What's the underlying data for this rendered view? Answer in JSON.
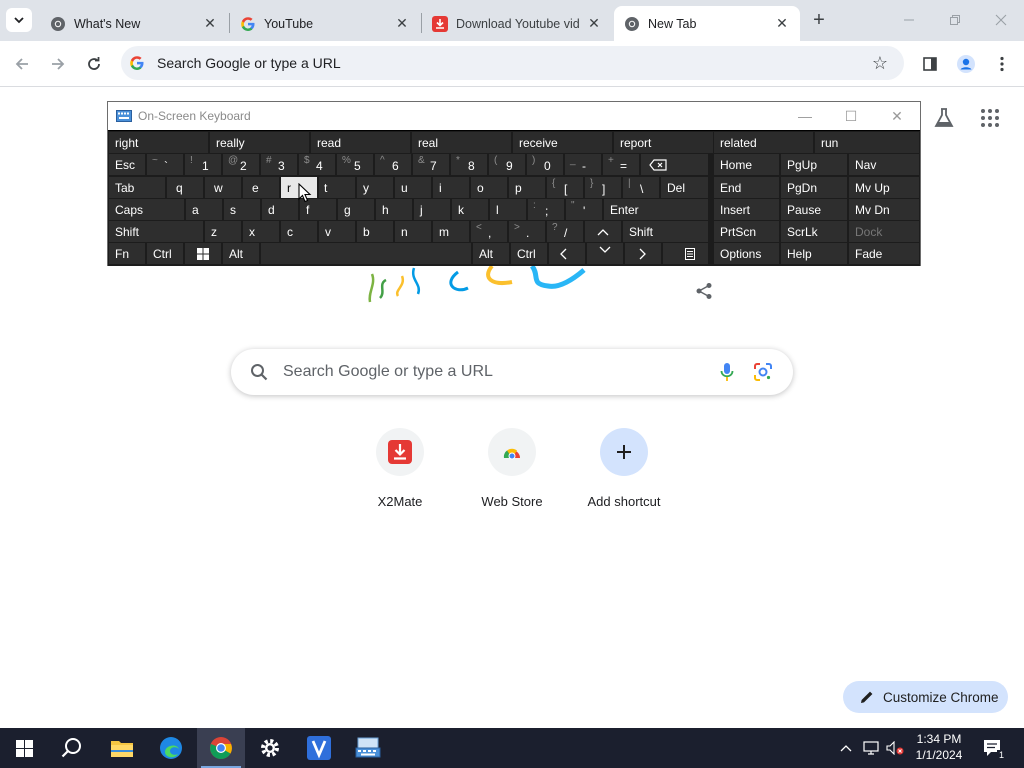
{
  "browser": {
    "tabs": [
      {
        "title": "What's New",
        "icon": "chrome-icon"
      },
      {
        "title": "YouTube",
        "icon": "google-g-icon"
      },
      {
        "title": "Download Youtube vid",
        "icon": "x2mate-download-icon"
      },
      {
        "title": "New Tab",
        "icon": "chrome-icon",
        "active": true
      }
    ],
    "omnibox": {
      "text": "Search Google or type a URL"
    }
  },
  "ntp": {
    "search_placeholder": "Search Google or type a URL",
    "shortcuts": [
      {
        "label": "X2Mate",
        "icon": "x2mate-download-icon"
      },
      {
        "label": "Web Store",
        "icon": "web-store-icon"
      },
      {
        "label": "Add shortcut",
        "icon": "plus-icon"
      }
    ],
    "customize_label": "Customize Chrome"
  },
  "osk": {
    "title": "On-Screen Keyboard",
    "predictions": [
      "right",
      "really",
      "read",
      "real",
      "receive",
      "report",
      "related",
      "run"
    ],
    "row1": {
      "esc": "Esc",
      "keys": [
        {
          "shift": "~",
          "main": "`"
        },
        {
          "shift": "!",
          "main": "1"
        },
        {
          "shift": "@",
          "main": "2"
        },
        {
          "shift": "#",
          "main": "3"
        },
        {
          "shift": "$",
          "main": "4"
        },
        {
          "shift": "%",
          "main": "5"
        },
        {
          "shift": "^",
          "main": "6"
        },
        {
          "shift": "&",
          "main": "7"
        },
        {
          "shift": "*",
          "main": "8"
        },
        {
          "shift": "(",
          "main": "9"
        },
        {
          "shift": ")",
          "main": "0"
        },
        {
          "shift": "_",
          "main": "-"
        },
        {
          "shift": "+",
          "main": "="
        }
      ]
    },
    "row2": {
      "tab": "Tab",
      "letters": [
        "q",
        "w",
        "e",
        "r",
        "t",
        "y",
        "u",
        "i",
        "o",
        "p"
      ],
      "brackets": [
        {
          "shift": "{",
          "main": "["
        },
        {
          "shift": "}",
          "main": "]"
        },
        {
          "shift": "|",
          "main": "\\"
        }
      ],
      "del": "Del"
    },
    "row3": {
      "caps": "Caps",
      "letters": [
        "a",
        "s",
        "d",
        "f",
        "g",
        "h",
        "j",
        "k",
        "l"
      ],
      "punct": [
        {
          "shift": ":",
          "main": ";"
        },
        {
          "shift": "\"",
          "main": "'"
        }
      ],
      "enter": "Enter"
    },
    "row4": {
      "shift": "Shift",
      "letters": [
        "z",
        "x",
        "c",
        "v",
        "b",
        "n",
        "m"
      ],
      "punct": [
        {
          "shift": "<",
          "main": ","
        },
        {
          "shift": ">",
          "main": "."
        },
        {
          "shift": "?",
          "main": "/"
        }
      ],
      "shift_right": "Shift"
    },
    "row5": {
      "fn": "Fn",
      "ctrl": "Ctrl",
      "alt": "Alt",
      "alt_right": "Alt",
      "ctrl_right": "Ctrl"
    },
    "nav": [
      [
        "Home",
        "PgUp",
        "Nav"
      ],
      [
        "End",
        "PgDn",
        "Mv Up"
      ],
      [
        "Insert",
        "Pause",
        "Mv Dn"
      ],
      [
        "PrtScn",
        "ScrLk",
        "Dock"
      ],
      [
        "Options",
        "Help",
        "Fade"
      ]
    ]
  },
  "taskbar": {
    "time": "1:34 PM",
    "date": "1/1/2024",
    "notification_count": "1"
  },
  "colors": {
    "tabstrip_bg": "#dfe3e9",
    "osk_key_bg": "#2e2e2e",
    "osk_highlight": "#e8e8e8",
    "taskbar_bg": "#1b1f2e",
    "customize_bg": "#d3e3fd",
    "x2mate_red": "#e53935"
  }
}
